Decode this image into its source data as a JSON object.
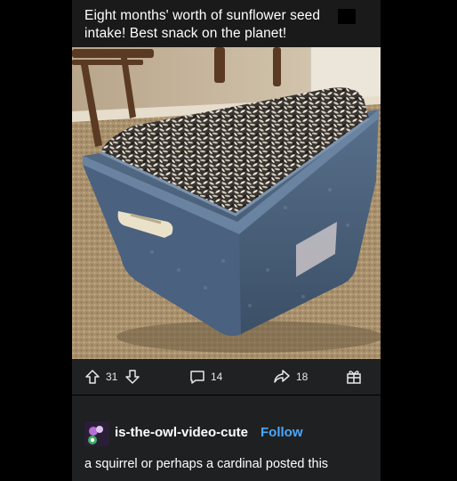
{
  "post": {
    "caption": "Eight months' worth of sunflower seed intake! Best snack on the planet!"
  },
  "actions": {
    "upvotes": "31",
    "comments": "14",
    "shares": "18"
  },
  "reblog": {
    "username": "is-the-owl-video-cute",
    "follow_label": "Follow",
    "text": "a squirrel or perhaps a cardinal posted this"
  },
  "colors": {
    "background": "#000000",
    "panel": "#1a1a1b",
    "follow_link": "#4aa8ff",
    "bin": "#4a5f78"
  },
  "icons": [
    "upvote-icon",
    "downvote-icon",
    "comment-icon",
    "share-icon",
    "gift-icon"
  ]
}
